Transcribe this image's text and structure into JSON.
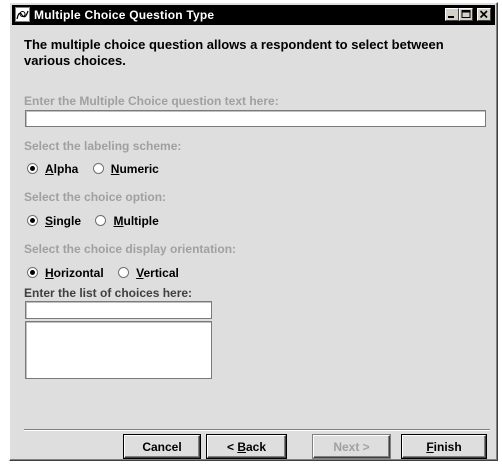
{
  "window": {
    "title": "Multiple Choice Question Type",
    "controls": {
      "minimize": "minimize",
      "maximize": "maximize",
      "close": "close"
    }
  },
  "description": "The multiple choice question allows a respondent to select between various choices.",
  "question_text": {
    "label": "Enter the Multiple Choice question text here:",
    "value": ""
  },
  "labeling_scheme": {
    "label": "Select the labeling scheme:",
    "options": [
      {
        "first": "A",
        "rest": "lpha",
        "checked": true
      },
      {
        "first": "N",
        "rest": "umeric",
        "checked": false
      }
    ]
  },
  "choice_option": {
    "label": "Select the choice option:",
    "options": [
      {
        "first": "S",
        "rest": "ingle",
        "checked": true
      },
      {
        "first": "M",
        "rest": "ultiple",
        "checked": false
      }
    ]
  },
  "display_orientation": {
    "label": "Select the choice display orientation:",
    "options": [
      {
        "first": "H",
        "rest": "orizontal",
        "checked": true
      },
      {
        "first": "V",
        "rest": "ertical",
        "checked": false
      }
    ]
  },
  "choices": {
    "label": "Enter the list of choices here:",
    "input_value": "",
    "list_items": []
  },
  "buttons": {
    "cancel": "Cancel",
    "back_prefix": "< ",
    "back_mnemonic": "B",
    "back_rest": "ack",
    "next": "Next >",
    "finish_mnemonic": "F",
    "finish_rest": "inish"
  },
  "colors": {
    "titlebar": "#000000",
    "dialog_bg": "#dedede",
    "disabled_text": "#a0a0a0"
  }
}
